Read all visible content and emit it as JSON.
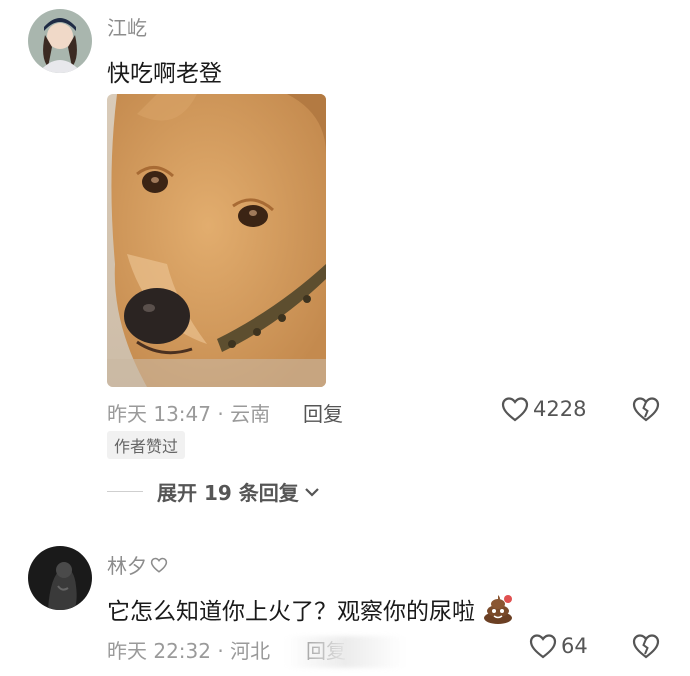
{
  "comments": [
    {
      "username": "江屹",
      "text": "快吃啊老登",
      "time_location": "昨天 13:47 · 云南",
      "reply_label": "回复",
      "likes": "4228",
      "author_badge": "作者赞过",
      "expand_label": "展开 19 条回复",
      "image": "dog-photo"
    },
    {
      "username": "林夕",
      "text": "它怎么知道你上火了？观察你的尿啦",
      "time_location": "昨天 22:32 · 河北",
      "reply_label": "回复",
      "likes": "64",
      "emoji": "poop-emoji"
    }
  ],
  "icons": {
    "like": "heart-outline-icon",
    "dislike": "broken-heart-icon",
    "expand": "chevron-down-icon",
    "name_heart": "small-heart-icon"
  }
}
